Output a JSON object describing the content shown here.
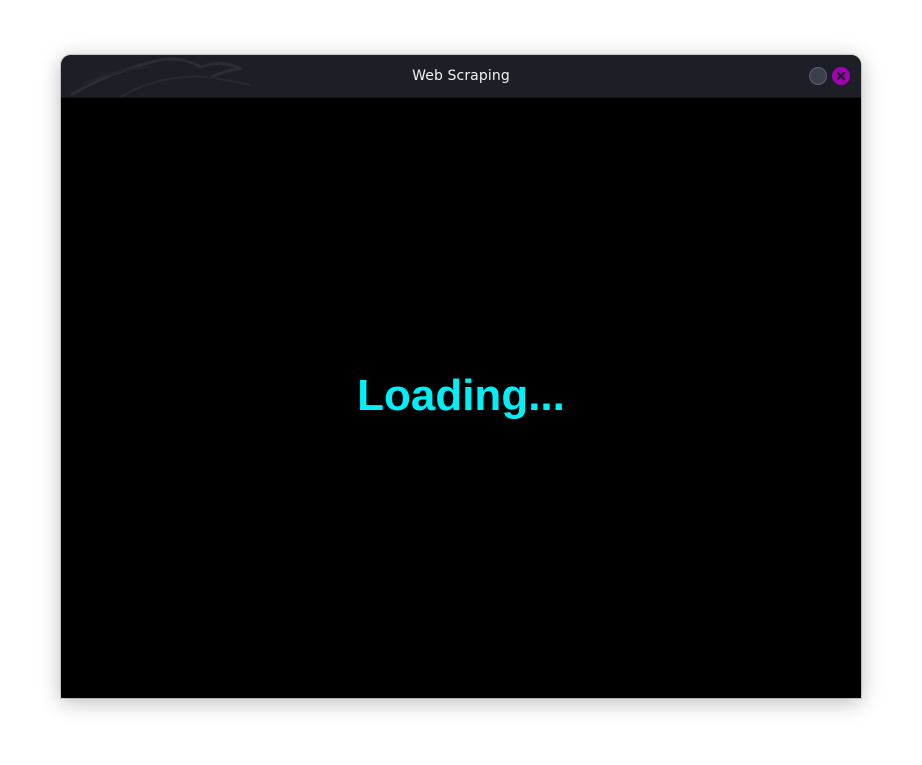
{
  "window": {
    "title": "Web Scraping",
    "controls": {
      "minimize_icon": "minimize-icon",
      "close_icon": "close-icon"
    }
  },
  "content": {
    "loading_text": "Loading..."
  },
  "colors": {
    "titlebar": "#1d1f26",
    "background": "#000000",
    "loading_text": "#00f0f8",
    "close_button": "#a100b3"
  }
}
